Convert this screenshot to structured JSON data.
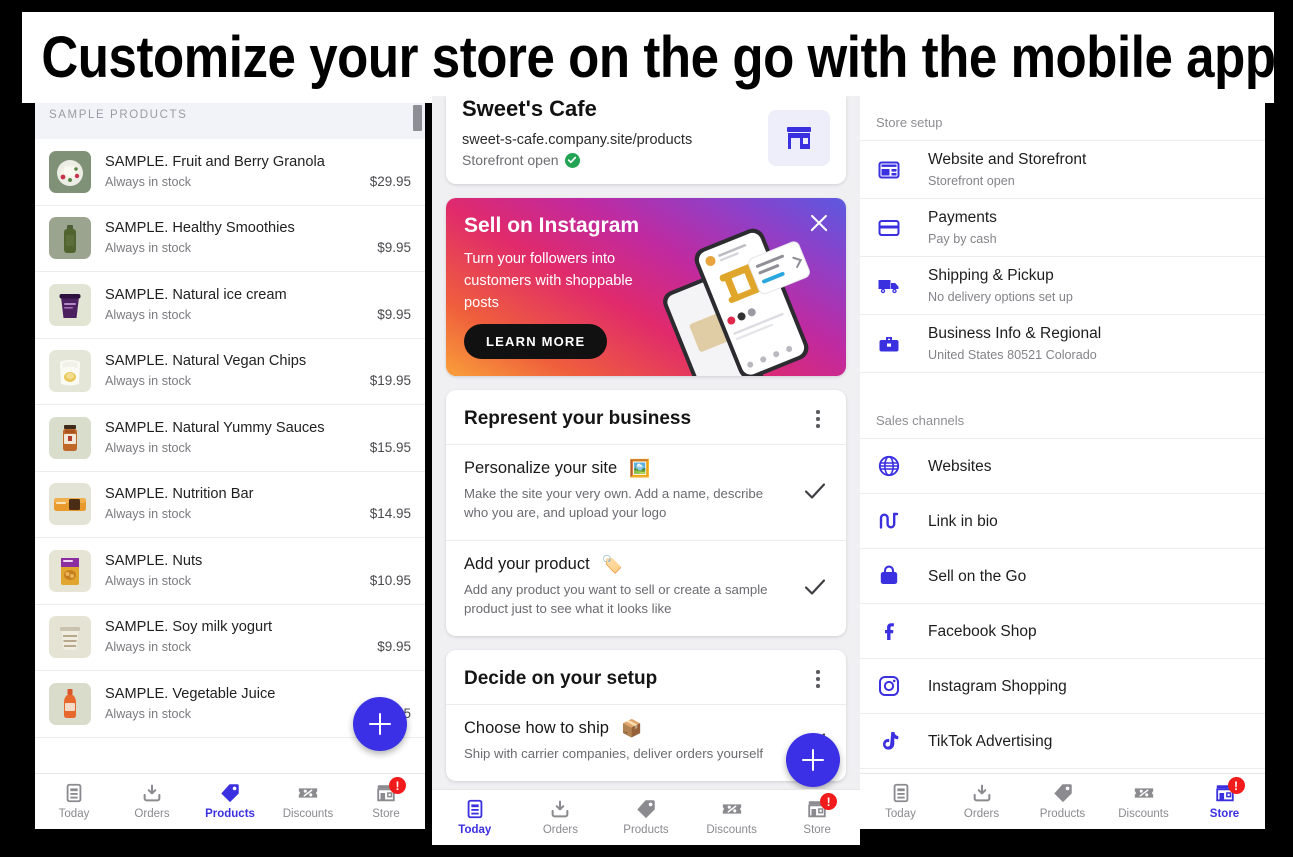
{
  "banner": {
    "headline": "Customize your store on the go with the mobile app"
  },
  "accent_colors": {
    "primary_purple": "#3B30E0",
    "fab_purple": "#3B30E6",
    "badge_red": "#F21B1B",
    "check_green": "#23A455",
    "sample_header_bg": "#F2F2F9"
  },
  "left_phone": {
    "section_header": "SAMPLE PRODUCTS",
    "stock_label": "Always in stock",
    "products": [
      {
        "name": "SAMPLE. Fruit and Berry Granola",
        "stock": "Always in stock",
        "price": "$29.95",
        "thumb": "granola-bowl-thumb"
      },
      {
        "name": "SAMPLE. Healthy Smoothies",
        "stock": "Always in stock",
        "price": "$9.95",
        "thumb": "green-bottle-thumb"
      },
      {
        "name": "SAMPLE. Natural ice cream",
        "stock": "Always in stock",
        "price": "$9.95",
        "thumb": "purple-tub-thumb"
      },
      {
        "name": "SAMPLE. Natural Vegan Chips",
        "stock": "Always in stock",
        "price": "$19.95",
        "thumb": "chips-bag-thumb"
      },
      {
        "name": "SAMPLE. Natural Yummy Sauces",
        "stock": "Always in stock",
        "price": "$15.95",
        "thumb": "sauce-jar-thumb"
      },
      {
        "name": "SAMPLE. Nutrition Bar",
        "stock": "Always in stock",
        "price": "$14.95",
        "thumb": "nutrition-bar-thumb"
      },
      {
        "name": "SAMPLE. Nuts",
        "stock": "Always in stock",
        "price": "$10.95",
        "thumb": "nuts-pack-thumb"
      },
      {
        "name": "SAMPLE. Soy milk yogurt",
        "stock": "Always in stock",
        "price": "$9.95",
        "thumb": "yogurt-cup-thumb"
      },
      {
        "name": "SAMPLE. Vegetable Juice",
        "stock": "Always in stock",
        "price": "$9.95",
        "thumb": "juice-bottle-thumb"
      }
    ],
    "fab_label": "+",
    "nav": {
      "active": "Products",
      "items": [
        {
          "label": "Today",
          "icon": "today-icon",
          "badge": null
        },
        {
          "label": "Orders",
          "icon": "orders-icon",
          "badge": null
        },
        {
          "label": "Products",
          "icon": "products-tag-icon",
          "badge": null
        },
        {
          "label": "Discounts",
          "icon": "discounts-icon",
          "badge": null
        },
        {
          "label": "Store",
          "icon": "store-icon",
          "badge": "!"
        }
      ]
    }
  },
  "middle_phone": {
    "store_card": {
      "name": "Sweet's Cafe",
      "url": "sweet-s-cafe.company.site/products",
      "status": "Storefront open",
      "status_icon": "green-check-icon",
      "tile_icon": "storefront-icon"
    },
    "instagram_banner": {
      "title": "Sell on Instagram",
      "subtitle": "Turn your followers into customers with shoppable posts",
      "cta": "LEARN MORE",
      "close_icon": "close-icon"
    },
    "cards": [
      {
        "title": "Represent your business",
        "menu_icon": "kebab-menu-icon",
        "rows": [
          {
            "title": "Personalize your site",
            "emoji": "🖼️",
            "desc": "Make the site your very own. Add a name, describe who you are, and upload your logo",
            "done": true
          },
          {
            "title": "Add your product",
            "emoji": "🏷️",
            "desc": "Add any product you want to sell or create a sample product just to see what it looks like",
            "done": true
          }
        ]
      },
      {
        "title": "Decide on your setup",
        "menu_icon": "kebab-menu-icon",
        "rows": [
          {
            "title": "Choose how to ship",
            "emoji": "📦",
            "desc": "Ship with carrier companies, deliver orders yourself",
            "done": true
          }
        ]
      }
    ],
    "fab_label": "+",
    "nav": {
      "active": "Today",
      "items": [
        {
          "label": "Today",
          "icon": "today-icon",
          "badge": null
        },
        {
          "label": "Orders",
          "icon": "orders-icon",
          "badge": null
        },
        {
          "label": "Products",
          "icon": "products-tag-icon",
          "badge": null
        },
        {
          "label": "Discounts",
          "icon": "discounts-icon",
          "badge": null
        },
        {
          "label": "Store",
          "icon": "store-icon",
          "badge": "!"
        }
      ]
    }
  },
  "right_phone": {
    "sections": [
      {
        "label": "Store setup",
        "rows": [
          {
            "title": "Website and Storefront",
            "sub": "Storefront open",
            "icon": "website-layout-icon"
          },
          {
            "title": "Payments",
            "sub": "Pay by cash",
            "icon": "credit-card-icon"
          },
          {
            "title": "Shipping & Pickup",
            "sub": "No delivery options set up",
            "icon": "delivery-truck-icon"
          },
          {
            "title": "Business Info & Regional",
            "sub": "United States 80521 Colorado",
            "icon": "briefcase-icon"
          }
        ]
      },
      {
        "label": "Sales channels",
        "rows": [
          {
            "title": "Websites",
            "sub": "",
            "icon": "globe-icon"
          },
          {
            "title": "Link in bio",
            "sub": "",
            "icon": "link-in-bio-icon"
          },
          {
            "title": "Sell on the Go",
            "sub": "",
            "icon": "shopping-bag-icon"
          },
          {
            "title": "Facebook Shop",
            "sub": "",
            "icon": "facebook-icon"
          },
          {
            "title": "Instagram Shopping",
            "sub": "",
            "icon": "instagram-icon"
          },
          {
            "title": "TikTok Advertising",
            "sub": "",
            "icon": "tiktok-icon"
          }
        ]
      }
    ],
    "nav": {
      "active": "Store",
      "items": [
        {
          "label": "Today",
          "icon": "today-icon",
          "badge": null
        },
        {
          "label": "Orders",
          "icon": "orders-icon",
          "badge": null
        },
        {
          "label": "Products",
          "icon": "products-tag-icon",
          "badge": null
        },
        {
          "label": "Discounts",
          "icon": "discounts-icon",
          "badge": null
        },
        {
          "label": "Store",
          "icon": "store-icon",
          "badge": "!"
        }
      ]
    }
  }
}
